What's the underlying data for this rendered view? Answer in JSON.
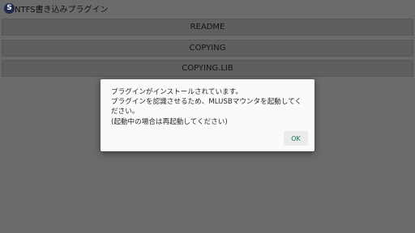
{
  "app": {
    "icon_letter": "S",
    "title": "NTFS書き込みプラグイン"
  },
  "menu": {
    "items": [
      {
        "label": "README"
      },
      {
        "label": "COPYING"
      },
      {
        "label": "COPYING.LIB"
      }
    ]
  },
  "dialog": {
    "lines": [
      "プラグインがインストールされています。",
      "プラグインを認識させるため、MLUSBマウンタを起動してく",
      "ださい。",
      "(起動中の場合は再起動してください)"
    ],
    "ok_label": "OK"
  },
  "colors": {
    "background": "#6b6b6b",
    "button": "#5f5f5f",
    "dialog": "#fafafa",
    "accent": "#1a6f5d"
  }
}
